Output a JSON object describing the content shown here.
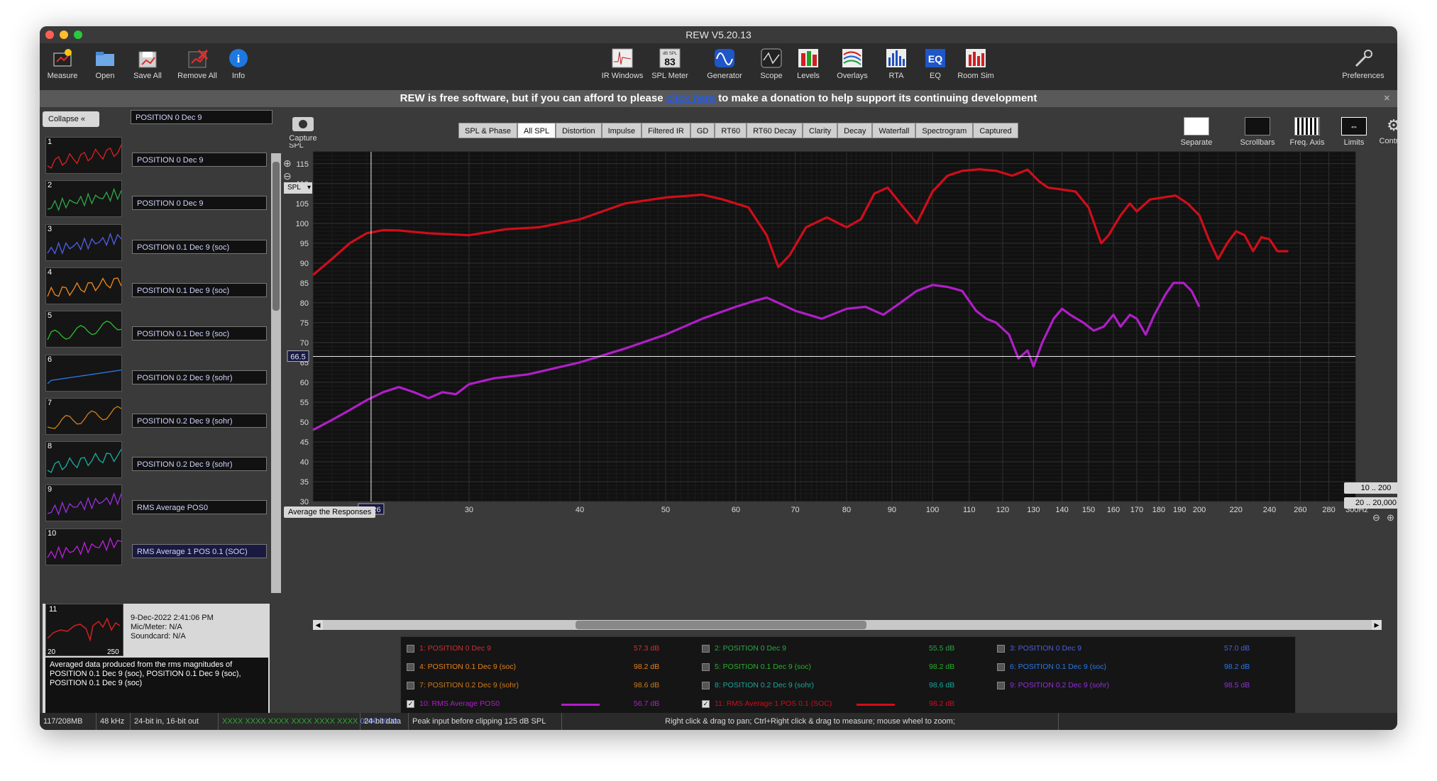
{
  "window": {
    "title": "REW V5.20.13"
  },
  "toolbar": {
    "left": [
      "Measure",
      "Open",
      "Save All",
      "Remove All",
      "Info"
    ],
    "center": [
      "IR Windows",
      "SPL Meter",
      "Generator",
      "Scope",
      "Levels",
      "Overlays",
      "RTA",
      "EQ",
      "Room Sim"
    ],
    "spl_meter_top": "dB SPL",
    "spl_meter_value": "83",
    "eq_glyph": "EQ",
    "right": "Preferences"
  },
  "donation": {
    "before": "REW is free software, but if you can afford to please",
    "link": "click here",
    "after": "to make a donation to help support its continuing development"
  },
  "panel": {
    "collapse_label": "Collapse",
    "header_name": "POSITION 0 Dec 9",
    "measurements": [
      {
        "num": "1",
        "name": "POSITION 0 Dec 9",
        "color": "#e02020"
      },
      {
        "num": "2",
        "name": "POSITION 0 Dec 9",
        "color": "#2ea84a"
      },
      {
        "num": "3",
        "name": "POSITION 0.1 Dec 9 (soc)",
        "color": "#5060e6"
      },
      {
        "num": "4",
        "name": "POSITION 0.1 Dec 9 (soc)",
        "color": "#f08a1e"
      },
      {
        "num": "5",
        "name": "POSITION 0.1 Dec 9 (soc)",
        "color": "#2ec02e"
      },
      {
        "num": "6",
        "name": "POSITION 0.2 Dec 9 (sohr)",
        "color": "#2a7bea"
      },
      {
        "num": "7",
        "name": "POSITION 0.2 Dec 9 (sohr)",
        "color": "#d8801a"
      },
      {
        "num": "8",
        "name": "POSITION 0.2 Dec 9 (sohr)",
        "color": "#1ab0a0"
      },
      {
        "num": "9",
        "name": "RMS Average POS0",
        "color": "#9a30e0"
      },
      {
        "num": "10",
        "name": "RMS Average 1 POS 0.1 (SOC)",
        "color": "#c020e0"
      }
    ],
    "selected": {
      "num": "11",
      "date": "9-Dec-2022 2:41:06 PM",
      "mic": "Mic/Meter: N/A",
      "soundcard": "Soundcard: N/A",
      "axis_left": "20",
      "axis_right": "250",
      "notes": "Averaged data produced from the rms magnitudes of POSITION 0.1 Dec 9 (soc), POSITION 0.1 Dec 9 (soc), POSITION 0.1 Dec 9 (soc)"
    }
  },
  "graph": {
    "capture": "Capture",
    "tabs": [
      "SPL & Phase",
      "All SPL",
      "Distortion",
      "Impulse",
      "Filtered IR",
      "GD",
      "RT60",
      "RT60 Decay",
      "Clarity",
      "Decay",
      "Waterfall",
      "Spectrogram",
      "Captured"
    ],
    "active_tab": "All SPL",
    "right_tools": [
      "Separate",
      "Scrollbars",
      "Freq. Axis",
      "Limits",
      "Controls"
    ],
    "spl_selector": "SPL",
    "avg_button": "Average the Responses",
    "range_buttons": [
      "10 .. 200",
      "20 .. 20,000"
    ],
    "cursor_x": "23.26",
    "cursor_y": "66.5"
  },
  "chart_data": {
    "type": "line",
    "ylabel": "SPL",
    "xlabel": "",
    "x_unit_label": "300Hz",
    "xscale": "log",
    "xlim": [
      20,
      300
    ],
    "ylim": [
      30,
      118
    ],
    "yticks": [
      30,
      35,
      40,
      45,
      50,
      55,
      60,
      65,
      70,
      75,
      80,
      85,
      90,
      95,
      100,
      105,
      110,
      115
    ],
    "xticks": [
      20,
      30,
      40,
      50,
      60,
      70,
      80,
      90,
      100,
      110,
      120,
      130,
      140,
      150,
      160,
      170,
      180,
      190,
      200,
      220,
      240,
      260,
      280
    ],
    "cursor": {
      "x": 23.26,
      "y": 66.5
    },
    "series": [
      {
        "name": "11: RMS Average 1 POS 0.1 (SOC)",
        "color": "#d10d1a",
        "points": [
          [
            20,
            87
          ],
          [
            21,
            91
          ],
          [
            22,
            95
          ],
          [
            23,
            97.5
          ],
          [
            24,
            98.3
          ],
          [
            25,
            98.2
          ],
          [
            27,
            97.5
          ],
          [
            30,
            97
          ],
          [
            33,
            98.5
          ],
          [
            36,
            99
          ],
          [
            40,
            101
          ],
          [
            45,
            105
          ],
          [
            50,
            106.5
          ],
          [
            55,
            107.2
          ],
          [
            58,
            106
          ],
          [
            62,
            104
          ],
          [
            65,
            97
          ],
          [
            67,
            89
          ],
          [
            69,
            92
          ],
          [
            72,
            99
          ],
          [
            76,
            101.5
          ],
          [
            80,
            99
          ],
          [
            83,
            101
          ],
          [
            86,
            107.5
          ],
          [
            89,
            109
          ],
          [
            92,
            105
          ],
          [
            96,
            100
          ],
          [
            100,
            108
          ],
          [
            104,
            112
          ],
          [
            108,
            113.2
          ],
          [
            113,
            113.6
          ],
          [
            118,
            113.2
          ],
          [
            123,
            112
          ],
          [
            128,
            113.5
          ],
          [
            132,
            110.5
          ],
          [
            135,
            109
          ],
          [
            140,
            108.5
          ],
          [
            145,
            108
          ],
          [
            150,
            104
          ],
          [
            155,
            95
          ],
          [
            158,
            97
          ],
          [
            163,
            102
          ],
          [
            167,
            105
          ],
          [
            170,
            103
          ],
          [
            176,
            106
          ],
          [
            182,
            106.5
          ],
          [
            188,
            107
          ],
          [
            194,
            105
          ],
          [
            200,
            102
          ],
          [
            205,
            96
          ],
          [
            210,
            91
          ],
          [
            215,
            95
          ],
          [
            220,
            98
          ],
          [
            225,
            97
          ],
          [
            230,
            93
          ],
          [
            235,
            96.5
          ],
          [
            240,
            96
          ],
          [
            245,
            93
          ],
          [
            252,
            93
          ]
        ]
      },
      {
        "name": "10: RMS Average POS0",
        "color": "#b01ec8",
        "points": [
          [
            20,
            48
          ],
          [
            21,
            50.5
          ],
          [
            22,
            53
          ],
          [
            23,
            55.5
          ],
          [
            24,
            57.5
          ],
          [
            25,
            58.8
          ],
          [
            26,
            57.5
          ],
          [
            27,
            56
          ],
          [
            28,
            57.5
          ],
          [
            29,
            57
          ],
          [
            30,
            59.5
          ],
          [
            32,
            61
          ],
          [
            35,
            62
          ],
          [
            40,
            65
          ],
          [
            45,
            68.5
          ],
          [
            50,
            72
          ],
          [
            55,
            76
          ],
          [
            60,
            79
          ],
          [
            63,
            80.5
          ],
          [
            65,
            81.3
          ],
          [
            67,
            80
          ],
          [
            70,
            78
          ],
          [
            75,
            76
          ],
          [
            80,
            78.5
          ],
          [
            84,
            79
          ],
          [
            88,
            77
          ],
          [
            92,
            80
          ],
          [
            96,
            83
          ],
          [
            100,
            84.5
          ],
          [
            104,
            84
          ],
          [
            108,
            83
          ],
          [
            112,
            78
          ],
          [
            115,
            76
          ],
          [
            118,
            75
          ],
          [
            122,
            72
          ],
          [
            125,
            66
          ],
          [
            128,
            68
          ],
          [
            130,
            64
          ],
          [
            133,
            70
          ],
          [
            137,
            76
          ],
          [
            140,
            78.5
          ],
          [
            143,
            77
          ],
          [
            148,
            75
          ],
          [
            152,
            73
          ],
          [
            156,
            74
          ],
          [
            160,
            77
          ],
          [
            163,
            74
          ],
          [
            167,
            77
          ],
          [
            170,
            76
          ],
          [
            174,
            72
          ],
          [
            178,
            77
          ],
          [
            183,
            82
          ],
          [
            187,
            85
          ],
          [
            192,
            85
          ],
          [
            196,
            83
          ],
          [
            200,
            79
          ]
        ]
      }
    ]
  },
  "legend": [
    {
      "label": "1: POSITION 0 Dec 9",
      "value": "57.3 dB",
      "color": "#d03030",
      "checked": false
    },
    {
      "label": "2: POSITION 0 Dec 9",
      "value": "55.5 dB",
      "color": "#2aa848",
      "checked": false
    },
    {
      "label": "3: POSITION 0 Dec 9",
      "value": "57.0 dB",
      "color": "#4a60e0",
      "checked": false
    },
    {
      "label": "4: POSITION 0.1 Dec 9 (soc)",
      "value": "98.2 dB",
      "color": "#e8801a",
      "checked": false
    },
    {
      "label": "5: POSITION 0.1 Dec 9 (soc)",
      "value": "98.2 dB",
      "color": "#28b02a",
      "checked": false
    },
    {
      "label": "6: POSITION 0.1 Dec 9 (soc)",
      "value": "98.2 dB",
      "color": "#2a78e8",
      "checked": false
    },
    {
      "label": "7: POSITION 0.2 Dec 9 (sohr)",
      "value": "98.6 dB",
      "color": "#d07a18",
      "checked": false
    },
    {
      "label": "8: POSITION 0.2 Dec 9 (sohr)",
      "value": "98.6 dB",
      "color": "#18a89a",
      "checked": false
    },
    {
      "label": "9: POSITION 0.2 Dec 9 (sohr)",
      "value": "98.5 dB",
      "color": "#9030d8",
      "checked": false
    },
    {
      "label": "10: RMS Average POS0",
      "value": "56.7 dB",
      "color": "#b01ec8",
      "checked": true
    },
    {
      "label": "11: RMS Average 1 POS 0.1 (SOC)",
      "value": "98.2 dB",
      "color": "#d10d1a",
      "checked": true
    }
  ],
  "status": {
    "memory": "117/208MB",
    "rate": "48 kHz",
    "bits": "24-bit in, 16-bit out",
    "meters_green": "XXXX XXXX  XXXX XXXX  XXXX XXXX",
    "meters_blue": "0000 0000",
    "data_bits": "24-bit data",
    "peak": "Peak input before clipping 125 dB SPL",
    "hint": "Right click & drag to pan; Ctrl+Right click & drag to measure; mouse wheel to zoom;"
  },
  "colors": {
    "background": "#111111",
    "grid": "#2e2e2e",
    "text": "#dddddd"
  }
}
